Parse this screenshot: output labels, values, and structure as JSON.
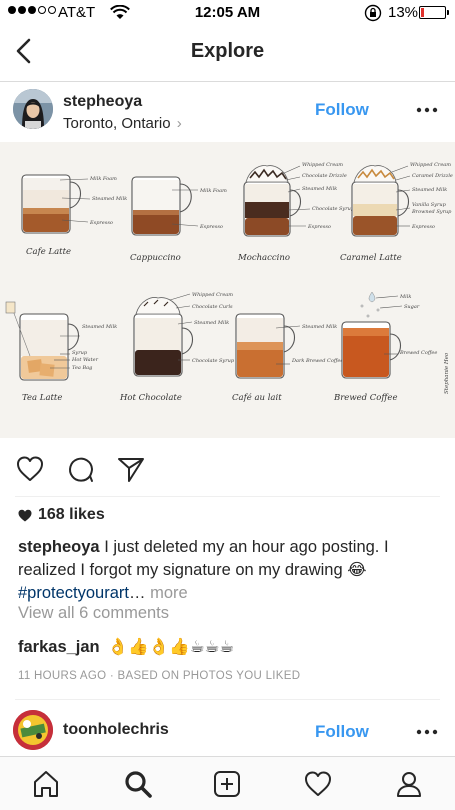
{
  "status_bar": {
    "carrier": "AT&T",
    "time": "12:05 AM",
    "battery": "13%",
    "battery_level": 0.13
  },
  "nav": {
    "title": "Explore",
    "back_icon": "chevron-left-icon"
  },
  "post": {
    "username": "stepheoya",
    "location": "Toronto, Ontario",
    "follow_label": "Follow",
    "likes": "168 likes",
    "caption_user": "stepheoya",
    "caption_text": "I just deleted my an hour ago posting. I realized I forgot my signature on my drawing",
    "caption_emoji": "😂",
    "caption_tag": "#protectyourart",
    "caption_ellipsis": "…",
    "caption_more": "more",
    "view_comments": "View all 6 comments",
    "comment_user": "farkas_jan",
    "comment_text": "👌👍👌👍☕☕☕",
    "timestamp": "11 HOURS AGO · BASED ON PHOTOS YOU LIKED"
  },
  "drawing": {
    "labels": {
      "cafe_latte": "Cafe Latte",
      "cappuccino": "Cappuccino",
      "mochaccino": "Mochaccino",
      "caramel_latte": "Caramel Latte",
      "tea_latte": "Tea Latte",
      "hot_chocolate": "Hot Chocolate",
      "cafe_au_lait": "Café au lait",
      "brewed_coffee": "Brewed Coffee",
      "signature": "Stephanie Heo"
    },
    "notes": {
      "milk_foam": "Milk Foam",
      "steamed_milk": "Steamed Milk",
      "espresso": "Espresso",
      "whipped_cream": "Whipped Cream",
      "chocolate_drizzle": "Chocolate Drizzle",
      "chocolate_syrup": "Chocolate Syrup",
      "caramel_drizzle": "Caramel Drizzle",
      "vanilla_syrup": "Vanilla Syrup",
      "browned_syrup": "Browned Syrup",
      "syrup": "Syrup",
      "hot_water": "Hot Water",
      "tea_bag": "Tea Bag",
      "chocolate_curls": "Chocolate Curls",
      "dark_brewed_coffee": "Dark Brewed Coffee",
      "milk": "Milk",
      "sugar": "Sugar",
      "brewed_coffee": "Brewed Coffee"
    }
  },
  "next_post": {
    "username": "toonholechris",
    "follow_label": "Follow"
  },
  "tabs": [
    "home-icon",
    "search-icon",
    "add-post-icon",
    "activity-heart-icon",
    "profile-icon"
  ],
  "colors": {
    "link_blue": "#3897f0",
    "hashtag": "#003569",
    "muted": "#999999",
    "text": "#262626"
  }
}
